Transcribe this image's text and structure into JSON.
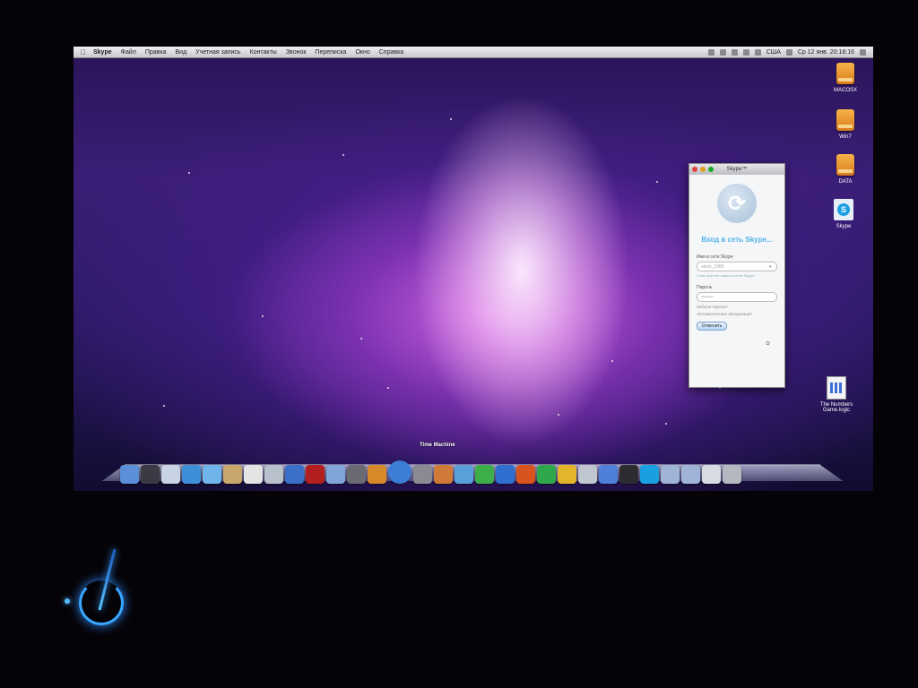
{
  "menubar": {
    "app": "Skype",
    "items": [
      "Файл",
      "Правка",
      "Вид",
      "Учетная запись",
      "Контакты",
      "Звонок",
      "Переписка",
      "Окно",
      "Справка"
    ],
    "lang": "СШA",
    "clock": "Ср 12 янв. 20:18:16"
  },
  "desktop_icons": [
    {
      "label": "MACOSX"
    },
    {
      "label": "Win7"
    },
    {
      "label": "DATA"
    },
    {
      "label": "Skype"
    },
    {
      "label": "The Numbers Game.logic"
    }
  ],
  "skype_window": {
    "title": "Skype™",
    "heading": "Вход в сеть Skype...",
    "username_label": "Имя в сети Skype",
    "username_value": "alexit_1985",
    "username_hint": "У вас еще нет имени в сети Skype?",
    "password_label": "Пароль",
    "password_value": "••••••••",
    "forgot_password": "Забыли пароль?",
    "remember_label": "Автоматическая авторизация",
    "cancel_button": "Отменить"
  },
  "dock": {
    "hover_label": "Time Machine",
    "icons": [
      {
        "name": "finder",
        "color": "#5b8fd8"
      },
      {
        "name": "dashboard",
        "color": "#3a3a44"
      },
      {
        "name": "mail",
        "color": "#c8d4e4"
      },
      {
        "name": "safari",
        "color": "#3f8fd8"
      },
      {
        "name": "ichat",
        "color": "#6fb4ea"
      },
      {
        "name": "address-book",
        "color": "#c9a66b"
      },
      {
        "name": "ical",
        "color": "#e4e4e4"
      },
      {
        "name": "preview",
        "color": "#b8c0cc"
      },
      {
        "name": "itunes",
        "color": "#3b6fc8"
      },
      {
        "name": "photo-booth",
        "color": "#b31e1e"
      },
      {
        "name": "iphoto",
        "color": "#7fa6d6"
      },
      {
        "name": "imovie",
        "color": "#6a6a72"
      },
      {
        "name": "garageband",
        "color": "#d88a2a"
      },
      {
        "name": "time-machine",
        "color": "#3a7ed8"
      },
      {
        "name": "system-preferences",
        "color": "#8a8a92"
      },
      {
        "name": "keynote",
        "color": "#d07a3a"
      },
      {
        "name": "pages",
        "color": "#5aa0d8"
      },
      {
        "name": "numbers",
        "color": "#3cae4a"
      },
      {
        "name": "word",
        "color": "#2f6fd0"
      },
      {
        "name": "powerpoint",
        "color": "#d8541e"
      },
      {
        "name": "excel",
        "color": "#2ea84a"
      },
      {
        "name": "outlook",
        "color": "#e2b52a"
      },
      {
        "name": "iwork-doc",
        "color": "#c0c6d0"
      },
      {
        "name": "app-store",
        "color": "#4f7fd8"
      },
      {
        "name": "photo",
        "color": "#2c2c30"
      },
      {
        "name": "skype",
        "color": "#1a9fe0"
      },
      {
        "name": "applications-folder",
        "color": "#9fb4d6"
      },
      {
        "name": "documents-folder",
        "color": "#9fb4d6"
      },
      {
        "name": "downloads-stack",
        "color": "#d6dbe4"
      },
      {
        "name": "trash",
        "color": "#b4b8c0"
      }
    ]
  }
}
